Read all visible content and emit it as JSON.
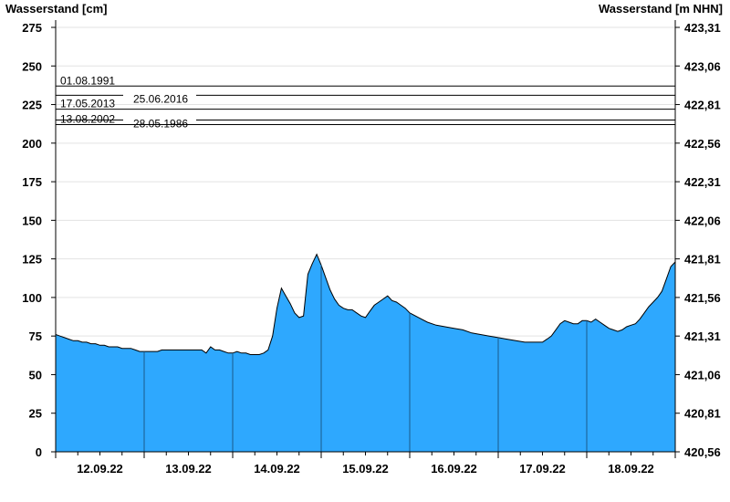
{
  "chart_data": {
    "type": "area",
    "ylabel_left": "Wasserstand [cm]",
    "ylabel_right": "Wasserstand [m NHN]",
    "ylim": [
      0,
      275
    ],
    "yticks_left": [
      "0",
      "25",
      "50",
      "75",
      "100",
      "125",
      "150",
      "175",
      "200",
      "225",
      "250",
      "275"
    ],
    "yticks_right": [
      "420,56",
      "420,81",
      "421,06",
      "421,31",
      "421,56",
      "421,81",
      "422,06",
      "422,31",
      "422,56",
      "422,81",
      "423,06",
      "423,31"
    ],
    "xlim": [
      0,
      7
    ],
    "xticks": [
      {
        "x": 0.5,
        "label": "12.09.22"
      },
      {
        "x": 1.5,
        "label": "13.09.22"
      },
      {
        "x": 2.5,
        "label": "14.09.22"
      },
      {
        "x": 3.5,
        "label": "15.09.22"
      },
      {
        "x": 4.5,
        "label": "16.09.22"
      },
      {
        "x": 5.5,
        "label": "17.09.22"
      },
      {
        "x": 6.5,
        "label": "18.09.22"
      }
    ],
    "day_boundaries": [
      1,
      2,
      3,
      4,
      5,
      6
    ],
    "grid": true,
    "fill_color": "#2ea8fe",
    "reference_levels": [
      {
        "label": "01.08.1991",
        "value": 237
      },
      {
        "label": "25.06.2016",
        "value": 231
      },
      {
        "label": "17.05.2013",
        "value": 222
      },
      {
        "label": "28.05.1986",
        "value": 215
      },
      {
        "label": "13.08.2002",
        "value": 212
      }
    ],
    "series": [
      {
        "x": [
          0,
          0.05,
          0.1,
          0.15,
          0.2,
          0.25,
          0.3,
          0.35,
          0.4,
          0.45,
          0.5,
          0.55,
          0.6,
          0.65,
          0.7,
          0.75,
          0.8,
          0.85,
          0.9,
          0.95,
          1.0,
          1.05,
          1.1,
          1.15,
          1.2,
          1.25,
          1.3,
          1.35,
          1.4,
          1.45,
          1.5,
          1.55,
          1.6,
          1.65,
          1.7,
          1.75,
          1.8,
          1.85,
          1.9,
          1.95,
          2.0,
          2.05,
          2.1,
          2.15,
          2.2,
          2.25,
          2.3,
          2.35,
          2.4,
          2.45,
          2.5,
          2.55,
          2.6,
          2.65,
          2.7,
          2.75,
          2.8,
          2.85,
          2.9,
          2.95,
          3.0,
          3.05,
          3.1,
          3.15,
          3.2,
          3.25,
          3.3,
          3.35,
          3.4,
          3.45,
          3.5,
          3.55,
          3.6,
          3.65,
          3.7,
          3.75,
          3.8,
          3.85,
          3.9,
          3.95,
          4.0,
          4.1,
          4.2,
          4.3,
          4.4,
          4.5,
          4.6,
          4.7,
          4.8,
          4.9,
          5.0,
          5.1,
          5.2,
          5.3,
          5.4,
          5.5,
          5.55,
          5.6,
          5.65,
          5.7,
          5.75,
          5.8,
          5.85,
          5.9,
          5.95,
          6.0,
          6.05,
          6.1,
          6.15,
          6.2,
          6.25,
          6.3,
          6.35,
          6.4,
          6.45,
          6.5,
          6.55,
          6.6,
          6.65,
          6.7,
          6.75,
          6.8,
          6.85,
          6.9,
          6.95,
          7.0
        ],
        "y": [
          76,
          75,
          74,
          73,
          72,
          72,
          71,
          71,
          70,
          70,
          69,
          69,
          68,
          68,
          68,
          67,
          67,
          67,
          66,
          65,
          65,
          65,
          65,
          65,
          66,
          66,
          66,
          66,
          66,
          66,
          66,
          66,
          66,
          66,
          64,
          68,
          66,
          66,
          65,
          64,
          64,
          65,
          64,
          64,
          63,
          63,
          63,
          64,
          66,
          75,
          93,
          106,
          101,
          96,
          90,
          87,
          88,
          115,
          122,
          128,
          121,
          113,
          105,
          99,
          95,
          93,
          92,
          92,
          90,
          88,
          87,
          91,
          95,
          97,
          99,
          101,
          98,
          97,
          95,
          93,
          90,
          87,
          84,
          82,
          81,
          80,
          79,
          77,
          76,
          75,
          74,
          73,
          72,
          71,
          71,
          71,
          73,
          75,
          79,
          83,
          85,
          84,
          83,
          83,
          85,
          85,
          84,
          86,
          84,
          82,
          80,
          79,
          78,
          79,
          81,
          82,
          83,
          86,
          90,
          94,
          97,
          100,
          104,
          112,
          120,
          123
        ]
      }
    ]
  }
}
